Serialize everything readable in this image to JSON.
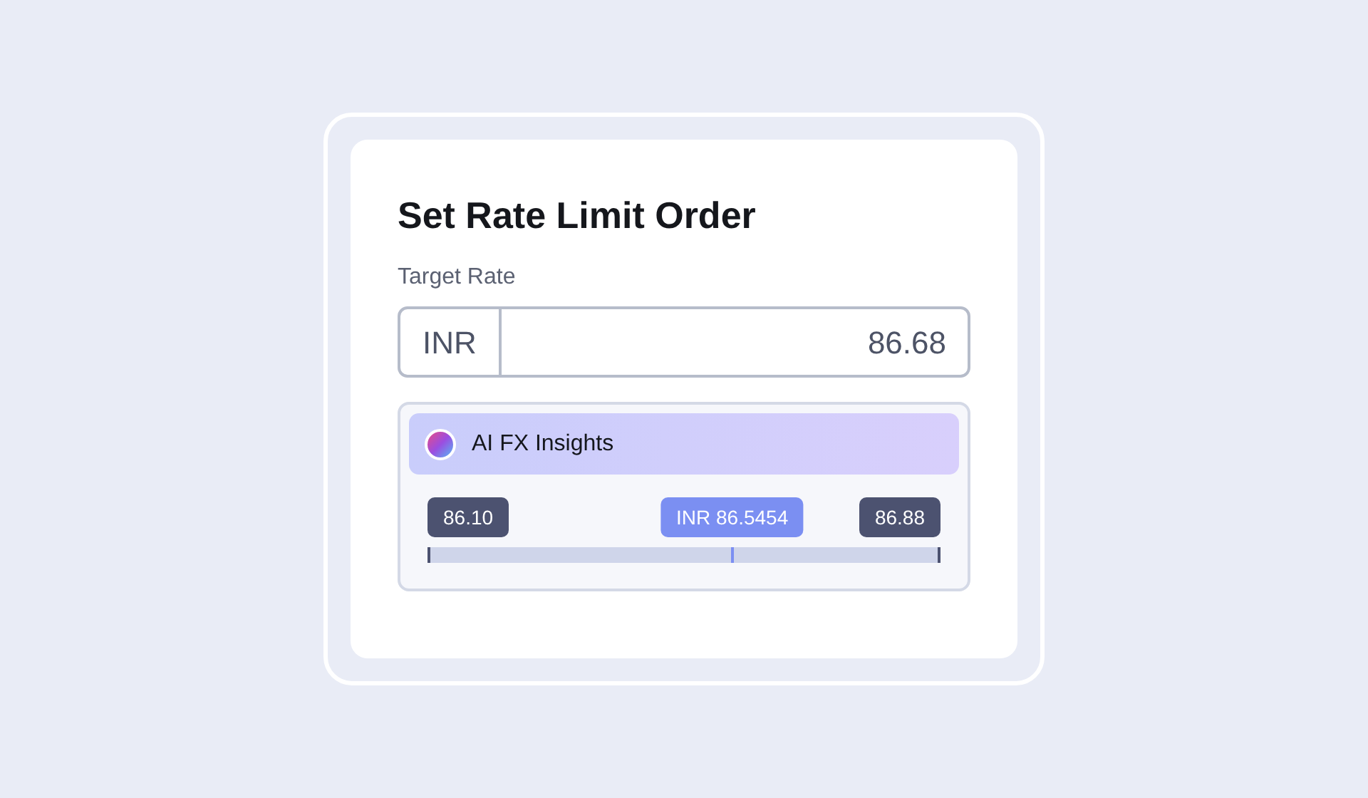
{
  "title": "Set Rate Limit Order",
  "target_rate": {
    "label": "Target Rate",
    "currency": "INR",
    "value": "86.68"
  },
  "insights": {
    "title": "AI FX Insights",
    "min": "86.10",
    "max": "86.88",
    "current": "INR 86.5454",
    "level": 0.594
  }
}
